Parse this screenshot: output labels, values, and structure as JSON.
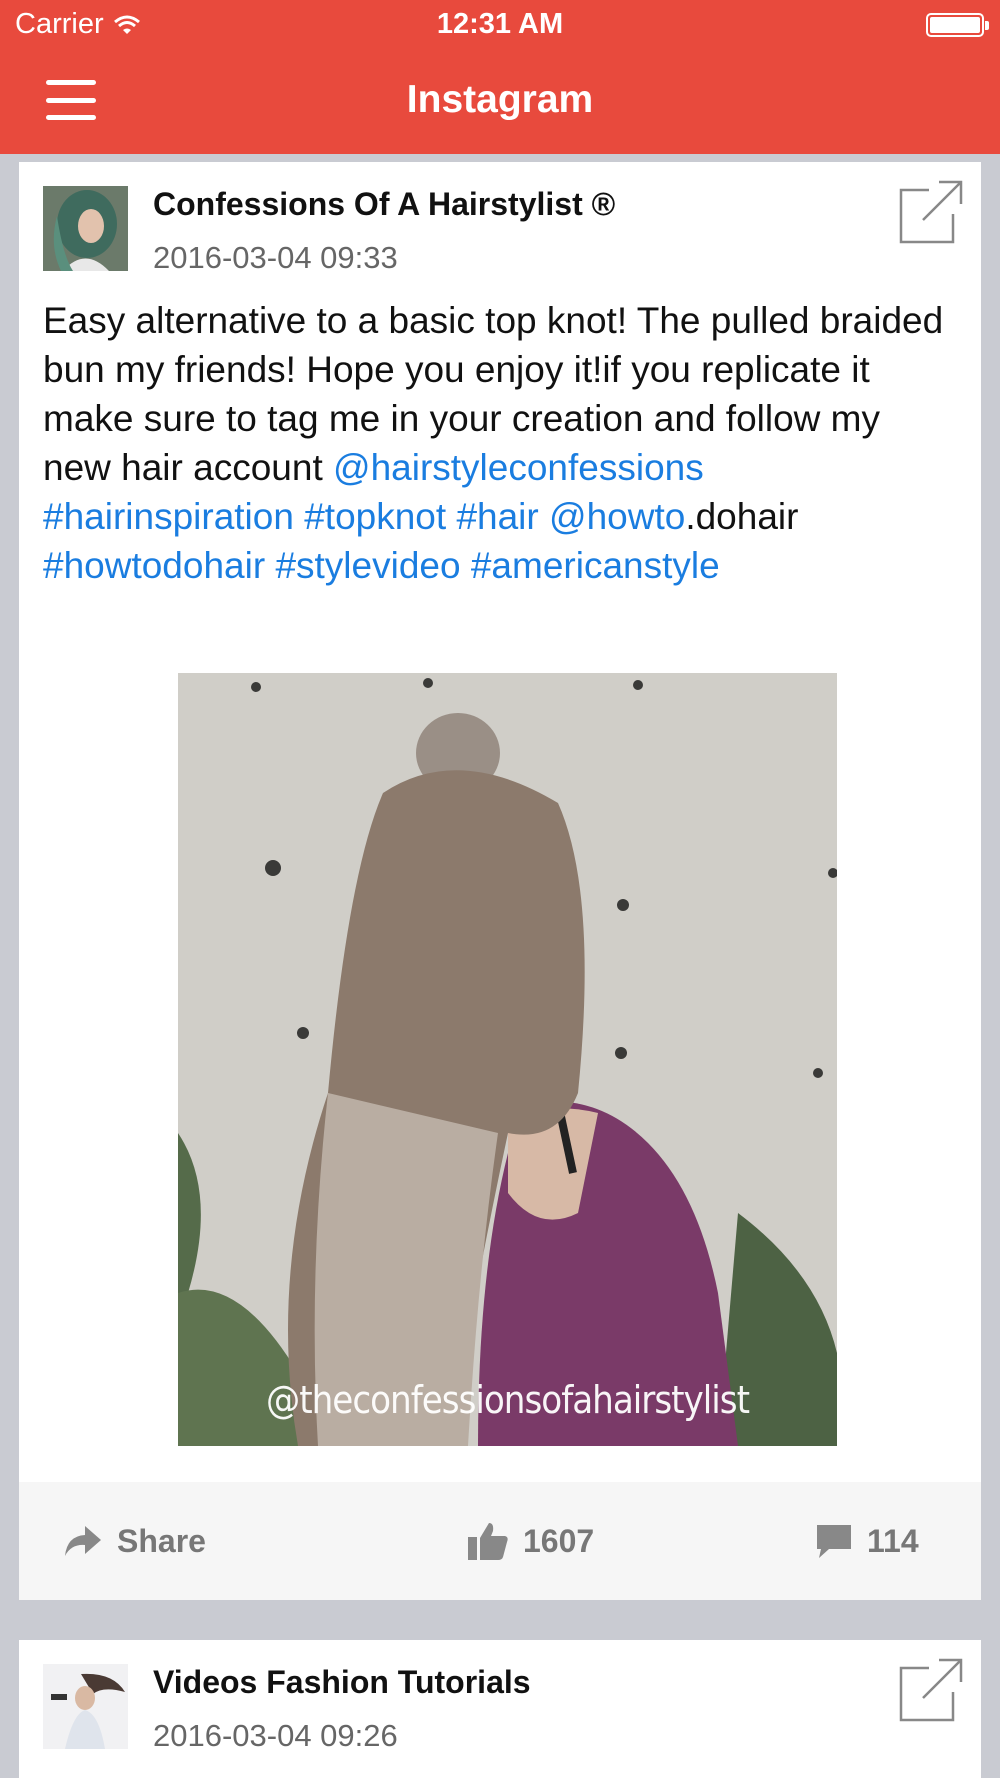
{
  "status_bar": {
    "carrier": "Carrier",
    "time": "12:31 AM"
  },
  "header": {
    "title": "Instagram",
    "icons": [
      "menu-icon"
    ],
    "color": "#e84a3d"
  },
  "posts": [
    {
      "author": "Confessions Of A Hairstylist ®",
      "date": "2016-03-04 09:33",
      "caption": [
        {
          "text": "Easy alternative to a basic top knot! The pulled braided bun my friends! Hope you enjoy it!if you replicate it make sure to tag me in your creation and follow my new hair account ",
          "link": false
        },
        {
          "text": "@hairstyleconfessions",
          "link": true
        },
        {
          "text": " ",
          "link": false
        },
        {
          "text": "#hairinspiration",
          "link": true
        },
        {
          "text": " ",
          "link": false
        },
        {
          "text": "#topknot",
          "link": true
        },
        {
          "text": " ",
          "link": false
        },
        {
          "text": "#hair",
          "link": true
        },
        {
          "text": " ",
          "link": false
        },
        {
          "text": "@howto",
          "link": true
        },
        {
          "text": ".dohair ",
          "link": false
        },
        {
          "text": "#howtodohair",
          "link": true
        },
        {
          "text": " ",
          "link": false
        },
        {
          "text": "#stylevideo",
          "link": true
        },
        {
          "text": " ",
          "link": false
        },
        {
          "text": "#americanstyle",
          "link": true
        }
      ],
      "image_watermark": "@theconfessionsofahairstylist",
      "share_label": "Share",
      "likes": "1607",
      "comments": "114"
    },
    {
      "author": "Videos Fashion Tutorials",
      "date": "2016-03-04 09:26"
    }
  ],
  "colors": {
    "link": "#1a7de0",
    "background": "#c9cbd2"
  }
}
